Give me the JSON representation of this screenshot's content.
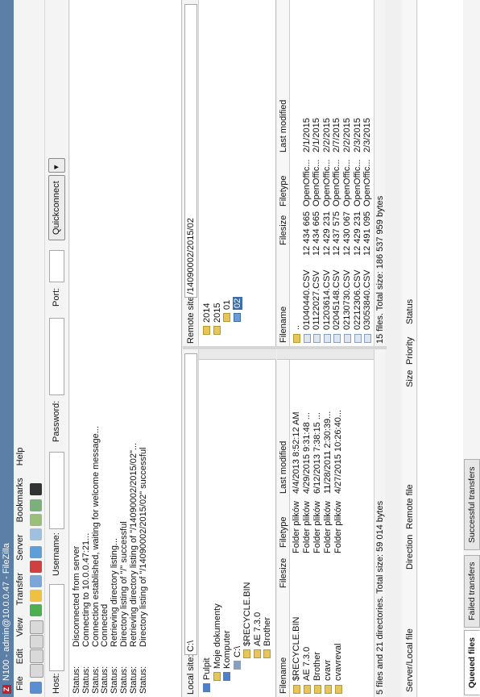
{
  "window": {
    "title": "N100 - admin@10.0.0.47 - FileZilla",
    "app_icon": "Z"
  },
  "menu": [
    "File",
    "Edit",
    "View",
    "Transfer",
    "Server",
    "Bookmarks",
    "Help"
  ],
  "quickconnect": {
    "host_label": "Host:",
    "host_value": "",
    "username_label": "Username:",
    "username_value": "",
    "password_label": "Password:",
    "password_value": "",
    "port_label": "Port:",
    "port_value": "",
    "button": "Quickconnect"
  },
  "log": [
    {
      "k": "Status:",
      "v": "Disconnected from server"
    },
    {
      "k": "Status:",
      "v": "Connecting to 10.0.0.47:21..."
    },
    {
      "k": "Status:",
      "v": "Connection established, waiting for welcome message..."
    },
    {
      "k": "Status:",
      "v": "Connected"
    },
    {
      "k": "Status:",
      "v": "Retrieving directory listing..."
    },
    {
      "k": "Status:",
      "v": "Directory listing of \"/\" successful"
    },
    {
      "k": "Status:",
      "v": "Retrieving directory listing of \"/14090002/2015/02\"..."
    },
    {
      "k": "Status:",
      "v": "Directory listing of \"/14090002/2015/02\" successful"
    }
  ],
  "local": {
    "label": "Local site:",
    "path": "C:\\",
    "tree": [
      {
        "label": "Pulpit",
        "icon": "desktop-icon",
        "level": 0
      },
      {
        "label": "Moje dokumenty",
        "icon": "folder-icon",
        "level": 1
      },
      {
        "label": "Komputer",
        "icon": "computer-icon",
        "level": 1
      },
      {
        "label": "C:\\",
        "icon": "drive-icon",
        "level": 2
      },
      {
        "label": "$RECYCLE.BIN",
        "icon": "folder-icon",
        "level": 3
      },
      {
        "label": "AE 7.3.0",
        "icon": "folder-icon",
        "level": 3
      },
      {
        "label": "Brother",
        "icon": "folder-icon",
        "level": 3
      }
    ],
    "columns": [
      "Filename",
      "Filesize",
      "Filetype",
      "Last modified"
    ],
    "files": [
      {
        "name": "$RECYCLE.BIN",
        "size": "",
        "type": "Folder plików",
        "modified": "4/4/2013 8:52:12 AM"
      },
      {
        "name": "AE 7.3.0",
        "size": "",
        "type": "Folder plików",
        "modified": "4/29/2015 9:31:48 ..."
      },
      {
        "name": "Brother",
        "size": "",
        "type": "Folder plików",
        "modified": "6/12/2013 7:38:15 ..."
      },
      {
        "name": "cvavr",
        "size": "",
        "type": "Folder plików",
        "modified": "11/28/2011 2:30:39..."
      },
      {
        "name": "cvavreval",
        "size": "",
        "type": "Folder plików",
        "modified": "4/27/2015 10:26:40..."
      }
    ],
    "status": "5 files and 21 directories. Total size: 59 014 bytes"
  },
  "remote": {
    "label": "Remote site:",
    "path": "/14090002/2015/02",
    "tree": [
      {
        "label": "2014",
        "level": 0,
        "selected": false
      },
      {
        "label": "2015",
        "level": 0,
        "selected": false
      },
      {
        "label": "01",
        "level": 1,
        "selected": false
      },
      {
        "label": "02",
        "level": 1,
        "selected": true
      }
    ],
    "columns": [
      "Filename",
      "Filesize",
      "Filetype",
      "Last modified"
    ],
    "files": [
      {
        "name": "..",
        "size": "",
        "type": "",
        "modified": ""
      },
      {
        "name": "01040440.CSV",
        "size": "12 434 665",
        "type": "OpenOffic...",
        "modified": "2/1/2015"
      },
      {
        "name": "01122027.CSV",
        "size": "12 434 665",
        "type": "OpenOffic...",
        "modified": "2/1/2015"
      },
      {
        "name": "01203614.CSV",
        "size": "12 429 231",
        "type": "OpenOffic...",
        "modified": "2/2/2015"
      },
      {
        "name": "02045148.CSV",
        "size": "12 437 575",
        "type": "OpenOffic...",
        "modified": "2/7/2015"
      },
      {
        "name": "02130730.CSV",
        "size": "12 430 067",
        "type": "OpenOffic...",
        "modified": "2/2/2015"
      },
      {
        "name": "02212306.CSV",
        "size": "12 429 231",
        "type": "OpenOffic...",
        "modified": "2/3/2015"
      },
      {
        "name": "03053840.CSV",
        "size": "12 491 095",
        "type": "OpenOffic...",
        "modified": "2/3/2015"
      }
    ],
    "status": "15 files. Total size: 186 537 959 bytes"
  },
  "queue": {
    "columns": [
      "Server/Local file",
      "Direction",
      "Remote file",
      "Size",
      "Priority",
      "Status"
    ],
    "tabs": [
      "Queued files",
      "Failed transfers",
      "Successful transfers"
    ]
  }
}
